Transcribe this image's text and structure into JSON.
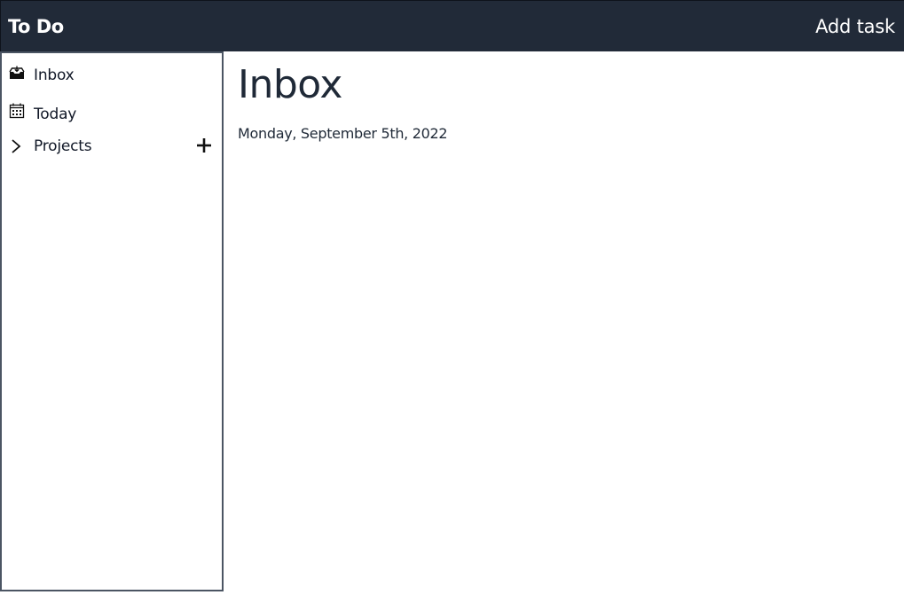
{
  "header": {
    "title": "To Do",
    "add_task_label": "Add task"
  },
  "sidebar": {
    "items": [
      {
        "label": "Inbox",
        "icon": "inbox-icon"
      },
      {
        "label": "Today",
        "icon": "calendar-icon"
      },
      {
        "label": "Projects",
        "icon": "chevron-right-icon",
        "action_icon": "plus-icon"
      }
    ]
  },
  "main": {
    "title": "Inbox",
    "date": "Monday, September 5th, 2022"
  },
  "colors": {
    "header_bg": "#212a38",
    "header_text": "#ffffff",
    "sidebar_border": "#4b5563",
    "text": "#1f2937"
  }
}
